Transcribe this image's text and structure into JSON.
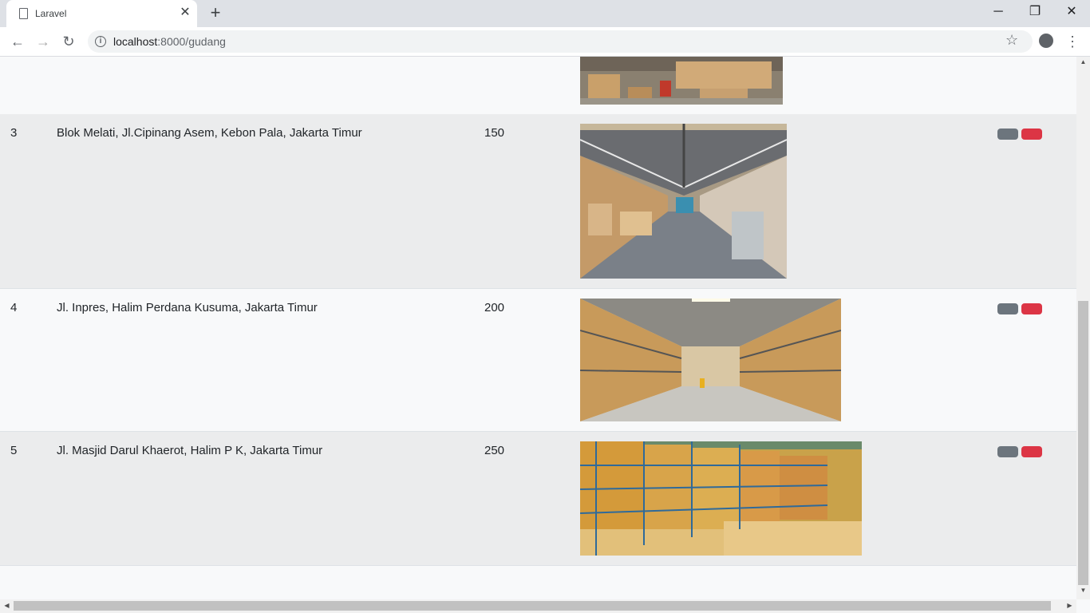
{
  "browser": {
    "tab_title": "Laravel",
    "tab_close": "✕",
    "new_tab": "+",
    "url_host": "localhost",
    "url_path": ":8000/gudang",
    "minimize": "─",
    "restore": "❐",
    "close": "✕",
    "back": "←",
    "forward": "→",
    "reload": "↻",
    "info": "i",
    "star": "☆",
    "menu": "⋮"
  },
  "rows": [
    {
      "no": "3",
      "address": "Blok Melati, Jl.Cipinang Asem, Kebon Pala, Jakarta Timur",
      "capacity": "150"
    },
    {
      "no": "4",
      "address": "Jl. Inpres, Halim Perdana Kusuma, Jakarta Timur",
      "capacity": "200"
    },
    {
      "no": "5",
      "address": "Jl. Masjid Darul Khaerot, Halim P K, Jakarta Timur",
      "capacity": "250"
    }
  ],
  "colors": {
    "edit_button": "#6c757d",
    "delete_button": "#dc3545"
  },
  "icons": [
    "document-icon",
    "info-icon",
    "star-icon",
    "account-icon",
    "menu-icon",
    "edit-button",
    "delete-button"
  ]
}
